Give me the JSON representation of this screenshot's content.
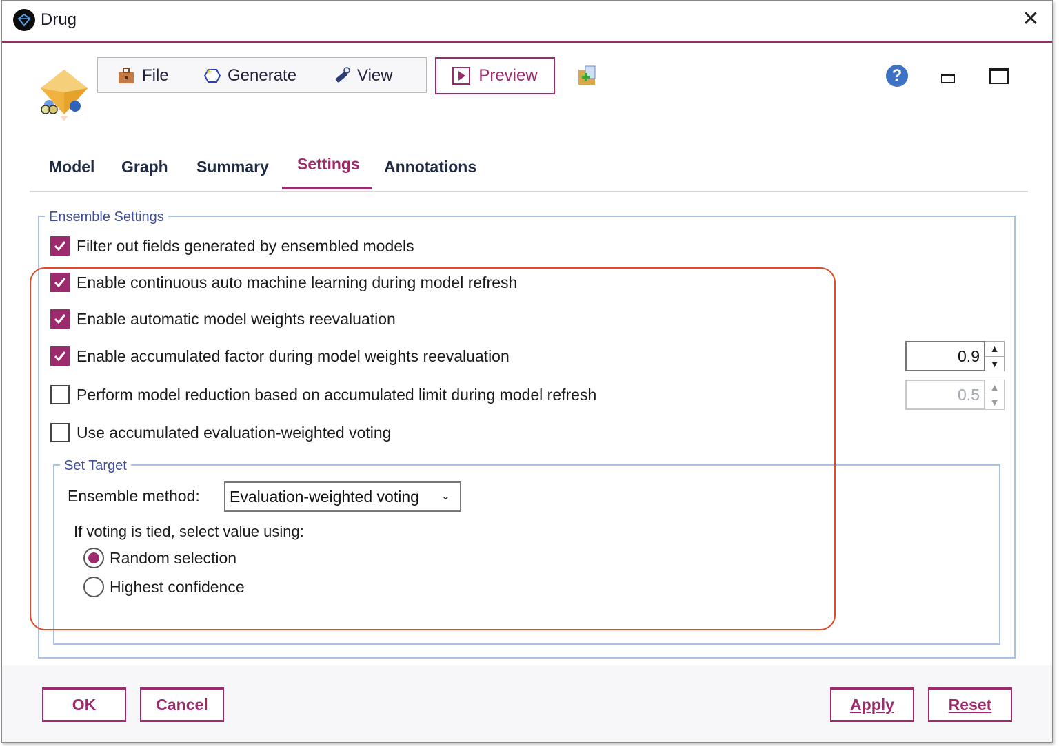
{
  "window": {
    "title": "Drug",
    "title_icon": "diamond-app-icon",
    "close_icon": "close-icon"
  },
  "toolbar": {
    "file_label": "File",
    "generate_label": "Generate",
    "view_label": "View",
    "preview_label": "Preview",
    "file_icon": "briefcase-icon",
    "generate_icon": "sparkle-hexagon-icon",
    "view_icon": "flashlight-icon",
    "preview_icon": "play-icon",
    "extra_icon": "add-to-project-icon",
    "help_icon": "help-icon",
    "minimize_icon": "minimize-icon",
    "maximize_icon": "maximize-icon"
  },
  "tabs": [
    {
      "label": "Model",
      "active": false
    },
    {
      "label": "Graph",
      "active": false
    },
    {
      "label": "Summary",
      "active": false
    },
    {
      "label": "Settings",
      "active": true
    },
    {
      "label": "Annotations",
      "active": false
    }
  ],
  "ensemble_settings": {
    "legend": "Ensemble Settings",
    "options": [
      {
        "label": "Filter out fields generated by ensembled models",
        "checked": true
      },
      {
        "label": "Enable continuous auto machine learning during model refresh",
        "checked": true
      },
      {
        "label": "Enable automatic model weights reevaluation",
        "checked": true
      },
      {
        "label": "Enable accumulated factor during model weights reevaluation",
        "checked": true
      },
      {
        "label": "Perform model reduction based on accumulated limit during model refresh",
        "checked": false
      },
      {
        "label": "Use accumulated evaluation-weighted voting",
        "checked": false
      }
    ],
    "accumulated_factor_value": "0.9",
    "accumulated_limit_value": "0.5",
    "accumulated_limit_enabled": false
  },
  "set_target": {
    "legend": "Set Target",
    "method_label": "Ensemble method:",
    "method_value": "Evaluation-weighted voting",
    "tie_label": "If voting is tied, select value using:",
    "radio_options": [
      {
        "label": "Random selection",
        "selected": true
      },
      {
        "label": "Highest confidence",
        "selected": false
      }
    ]
  },
  "footer": {
    "ok_label": "OK",
    "cancel_label": "Cancel",
    "apply_label": "Apply",
    "reset_label": "Reset"
  },
  "colors": {
    "accent": "#9b2b6c",
    "group_border": "#a9c1e4",
    "legend_text": "#3f4d97",
    "highlight_annotation": "#e04a2a",
    "help_icon": "#3d72c4"
  }
}
